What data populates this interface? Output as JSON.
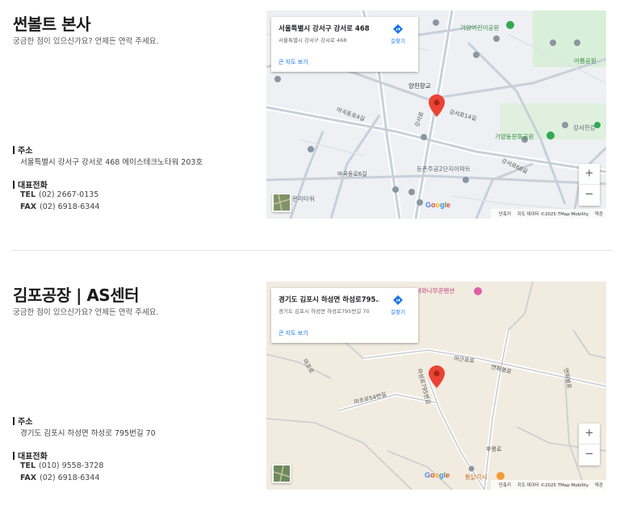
{
  "hq": {
    "title": "썬볼트 본사",
    "subtitle": "궁금한 점이 있으신가요? 언제든 연락 주세요.",
    "address_label": "주소",
    "address": "서울특별시 강서구 강서로 468 에이스테크노타워 203호",
    "phone_label": "대표전화",
    "tel_prefix": "TEL",
    "tel": "(02) 2667-0135",
    "fax_prefix": "FAX",
    "fax": "(02) 6918-6344",
    "map": {
      "info_title": "서울특별시 강서구 강서로 468",
      "info_address": "서울특별시 강서구 강서로 468",
      "directions": "길찾기",
      "larger_map": "큰 지도 보기",
      "labels": {
        "school": "양천향교",
        "park1": "가양어린이공원",
        "park2": "가양동문화공원",
        "park3": "아름공원",
        "apt": "등촌주공2단지아파트",
        "gangseo": "강서한강",
        "road1": "강서로14길",
        "road2": "마곡동로6길",
        "road3": "마곡동로4길",
        "road4": "강서로68길",
        "road5": "강서로",
        "tower": "온리타워"
      },
      "footer_shortcuts": "단축키",
      "footer_data": "지도 데이터 ©2025 TMap Mobility",
      "footer_terms": "약관"
    }
  },
  "factory": {
    "title": "김포공장 | AS센터",
    "subtitle": "궁금한 점이 있으신가요? 언제든 연락 주세요.",
    "address_label": "주소",
    "address": "경기도 김포시 하성면 하성로 795번길 70",
    "phone_label": "대표전화",
    "tel_prefix": "TEL",
    "tel": "(010) 9558-3728",
    "fax_prefix": "FAX",
    "fax": "(02) 6918-6344",
    "map": {
      "info_title": "경기도 김포시 하성면 하성로795...",
      "info_address": "경기도 김포시 하성면 하성로795번길 70",
      "directions": "길찾기",
      "larger_map": "큰 지도 보기",
      "labels": {
        "pension": "선녀와나무꾼펜션",
        "road1": "마근포로",
        "road2": "연화봉로",
        "road3": "마조로54번길",
        "road4": "하성로795번길",
        "road5": "후평로",
        "shop": "통닭각시",
        "road6": "마조로",
        "road7": "연화봉로"
      },
      "footer_shortcuts": "단축키",
      "footer_data": "지도 데이터 ©2025 TMap Mobility",
      "footer_terms": "약관"
    }
  },
  "common": {
    "zoom_in": "+",
    "zoom_out": "−",
    "google": [
      "G",
      "o",
      "o",
      "g",
      "l",
      "e"
    ]
  },
  "colors": {
    "pin": "#ea4335",
    "map_bg_city": "#eef0f3",
    "map_bg_rural": "#f1ebe0",
    "link": "#1a73e8"
  }
}
